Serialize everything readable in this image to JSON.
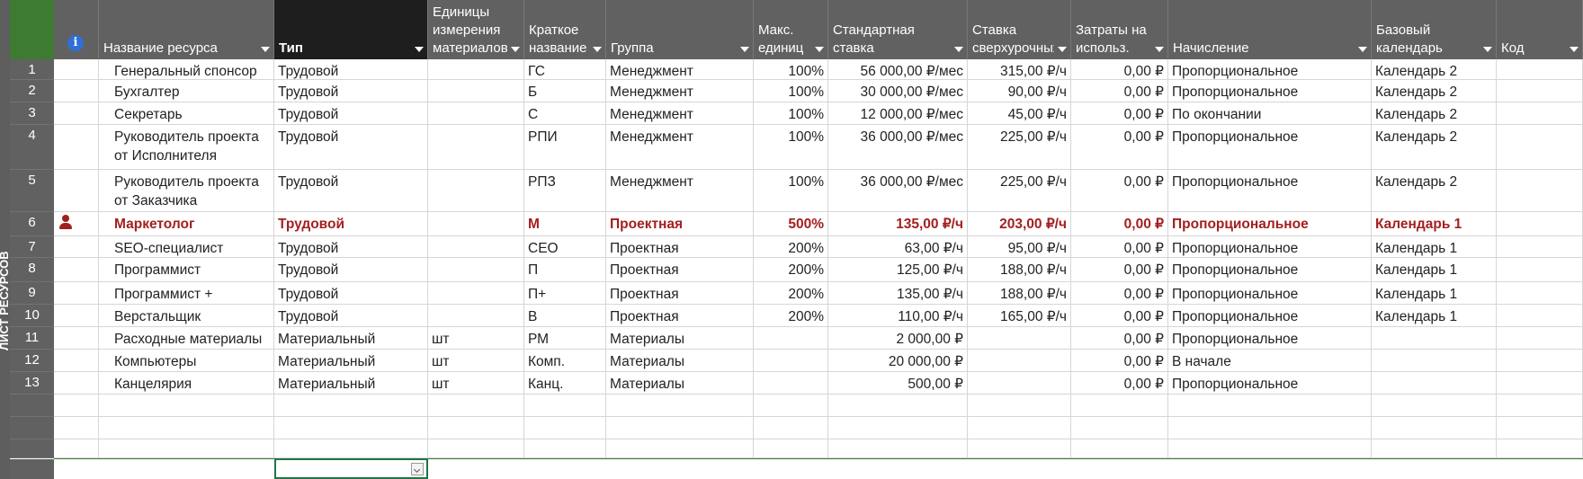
{
  "view_label": "ЛИСТ РЕСУРСОВ",
  "headers": [
    {
      "key": "info",
      "label": ""
    },
    {
      "key": "name",
      "label": "Название ресурса"
    },
    {
      "key": "type",
      "label": "Тип"
    },
    {
      "key": "units",
      "label": "Единицы\nизмерения\nматериалов"
    },
    {
      "key": "short",
      "label": "Краткое\nназвание"
    },
    {
      "key": "group",
      "label": "Группа"
    },
    {
      "key": "max",
      "label": "Макс.\nединиц"
    },
    {
      "key": "std",
      "label": "Стандартная\nставка"
    },
    {
      "key": "ovt",
      "label": "Ставка\nсверхурочных"
    },
    {
      "key": "cost",
      "label": "Затраты на\nиспольз."
    },
    {
      "key": "accrue",
      "label": "Начисление"
    },
    {
      "key": "cal",
      "label": "Базовый\nкалендарь"
    },
    {
      "key": "code",
      "label": "Код"
    }
  ],
  "rows": [
    {
      "id": "1",
      "name": "Генеральный спонсор",
      "type": "Трудовой",
      "units": "",
      "short": "ГС",
      "group": "Менеджмент",
      "max": "100%",
      "std": "56 000,00 ₽/мес",
      "ovt": "315,00 ₽/ч",
      "cost": "0,00 ₽",
      "accrue": "Пропорциональное",
      "cal": "Календарь 2",
      "code": ""
    },
    {
      "id": "2",
      "name": "Бухгалтер",
      "type": "Трудовой",
      "units": "",
      "short": "Б",
      "group": "Менеджмент",
      "max": "100%",
      "std": "30 000,00 ₽/мес",
      "ovt": "90,00 ₽/ч",
      "cost": "0,00 ₽",
      "accrue": "Пропорциональное",
      "cal": "Календарь 2",
      "code": ""
    },
    {
      "id": "3",
      "name": "Секретарь",
      "type": "Трудовой",
      "units": "",
      "short": "С",
      "group": "Менеджмент",
      "max": "100%",
      "std": "12 000,00 ₽/мес",
      "ovt": "45,00 ₽/ч",
      "cost": "0,00 ₽",
      "accrue": "По окончании",
      "cal": "Календарь 2",
      "code": ""
    },
    {
      "id": "4",
      "name": "Руководитель проекта от Исполнителя",
      "type": "Трудовой",
      "units": "",
      "short": "РПИ",
      "group": "Менеджмент",
      "max": "100%",
      "std": "36 000,00 ₽/мес",
      "ovt": "225,00 ₽/ч",
      "cost": "0,00 ₽",
      "accrue": "Пропорциональное",
      "cal": "Календарь 2",
      "code": ""
    },
    {
      "id": "5",
      "name": "Руководитель проекта от Заказчика",
      "type": "Трудовой",
      "units": "",
      "short": "РПЗ",
      "group": "Менеджмент",
      "max": "100%",
      "std": "36 000,00 ₽/мес",
      "ovt": "225,00 ₽/ч",
      "cost": "0,00 ₽",
      "accrue": "Пропорциональное",
      "cal": "Календарь 2",
      "code": ""
    },
    {
      "id": "6",
      "name": "Маркетолог",
      "type": "Трудовой",
      "units": "",
      "short": "М",
      "group": "Проектная",
      "max": "500%",
      "std": "135,00 ₽/ч",
      "ovt": "203,00 ₽/ч",
      "cost": "0,00 ₽",
      "accrue": "Пропорциональное",
      "cal": "Календарь 1",
      "code": ""
    },
    {
      "id": "7",
      "name": "SEO-специалист",
      "type": "Трудовой",
      "units": "",
      "short": "СЕО",
      "group": "Проектная",
      "max": "200%",
      "std": "63,00 ₽/ч",
      "ovt": "95,00 ₽/ч",
      "cost": "0,00 ₽",
      "accrue": "Пропорциональное",
      "cal": "Календарь 1",
      "code": ""
    },
    {
      "id": "8",
      "name": "Программист",
      "type": "Трудовой",
      "units": "",
      "short": "П",
      "group": "Проектная",
      "max": "200%",
      "std": "125,00 ₽/ч",
      "ovt": "188,00 ₽/ч",
      "cost": "0,00 ₽",
      "accrue": "Пропорциональное",
      "cal": "Календарь 1",
      "code": ""
    },
    {
      "id": "9",
      "name": "Программист +",
      "type": "Трудовой",
      "units": "",
      "short": "П+",
      "group": "Проектная",
      "max": "200%",
      "std": "135,00 ₽/ч",
      "ovt": "188,00 ₽/ч",
      "cost": "0,00 ₽",
      "accrue": "Пропорциональное",
      "cal": "Календарь 1",
      "code": ""
    },
    {
      "id": "10",
      "name": "Верстальщик",
      "type": "Трудовой",
      "units": "",
      "short": "В",
      "group": "Проектная",
      "max": "200%",
      "std": "110,00 ₽/ч",
      "ovt": "165,00 ₽/ч",
      "cost": "0,00 ₽",
      "accrue": "Пропорциональное",
      "cal": "Календарь 1",
      "code": ""
    },
    {
      "id": "11",
      "name": "Расходные материалы",
      "type": "Материальный",
      "units": "шт",
      "short": "РМ",
      "group": "Материалы",
      "max": "",
      "std": "2 000,00 ₽",
      "ovt": "",
      "cost": "0,00 ₽",
      "accrue": "Пропорциональное",
      "cal": "",
      "code": ""
    },
    {
      "id": "12",
      "name": "Компьютеры",
      "type": "Материальный",
      "units": "шт",
      "short": "Комп.",
      "group": "Материалы",
      "max": "",
      "std": "20 000,00 ₽",
      "ovt": "",
      "cost": "0,00 ₽",
      "accrue": "В начале",
      "cal": "",
      "code": ""
    },
    {
      "id": "13",
      "name": "Канцелярия",
      "type": "Материальный",
      "units": "шт",
      "short": "Канц.",
      "group": "Материалы",
      "max": "",
      "std": "500,00 ₽",
      "ovt": "",
      "cost": "0,00 ₽",
      "accrue": "Пропорциональное",
      "cal": "",
      "code": ""
    }
  ],
  "colors": {
    "header_bg": "#616161",
    "active_header_bg": "#1e1e1e",
    "highlight_text": "#a31f1f",
    "accent_green": "#3c7b31"
  },
  "icons": {
    "info": "info-icon",
    "overallocated": "person-icon"
  }
}
